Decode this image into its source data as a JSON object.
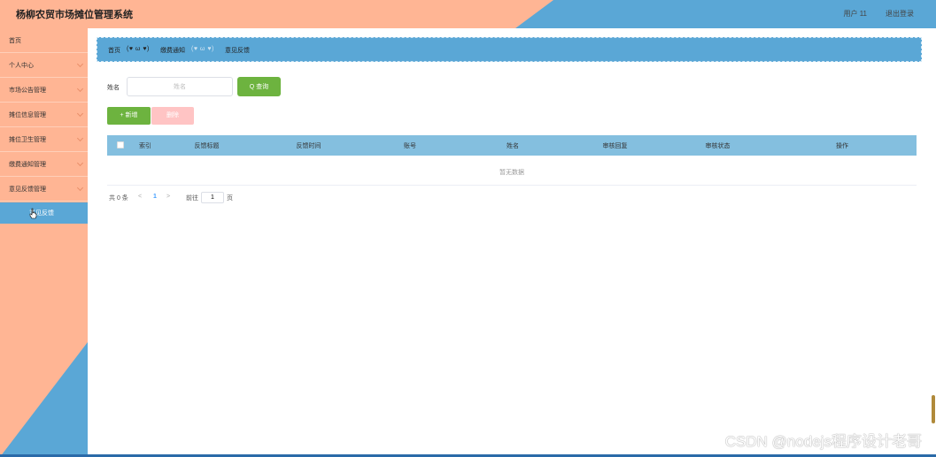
{
  "header": {
    "title": "杨柳农贸市场摊位管理系统",
    "user": "用户 11",
    "logout": "退出登录"
  },
  "sidebar": {
    "items": [
      {
        "label": "首页"
      },
      {
        "label": "个人中心"
      },
      {
        "label": "市场公告管理"
      },
      {
        "label": "摊位信息管理"
      },
      {
        "label": "摊位卫生管理"
      },
      {
        "label": "缴费通知管理"
      },
      {
        "label": "意见反馈管理"
      }
    ],
    "active_sub": "意见反馈"
  },
  "breadcrumb": {
    "items": [
      "首页",
      "缴费通知",
      "意见反馈"
    ],
    "separator": "(♥ ω ♥)"
  },
  "search": {
    "label": "姓名",
    "placeholder": "姓名",
    "query_button": "Q 查询"
  },
  "actions": {
    "add": "+ 新增",
    "delete": "删除"
  },
  "table": {
    "columns": [
      "索引",
      "反馈标题",
      "反馈时间",
      "账号",
      "姓名",
      "审核回复",
      "审核状态",
      "操作"
    ],
    "empty_text": "暂无数据"
  },
  "pagination": {
    "total": "共 0 条",
    "prev": "<",
    "page": "1",
    "next": ">",
    "goto_label": "前往",
    "goto_value": "1",
    "page_unit": "页"
  },
  "watermark": "CSDN @nodejs程序设计老哥",
  "colors": {
    "peach": "#ffb594",
    "blue": "#5aa7d6",
    "table_header": "#84bfdf",
    "green": "#6db33f",
    "pink": "#ffc4c4"
  }
}
